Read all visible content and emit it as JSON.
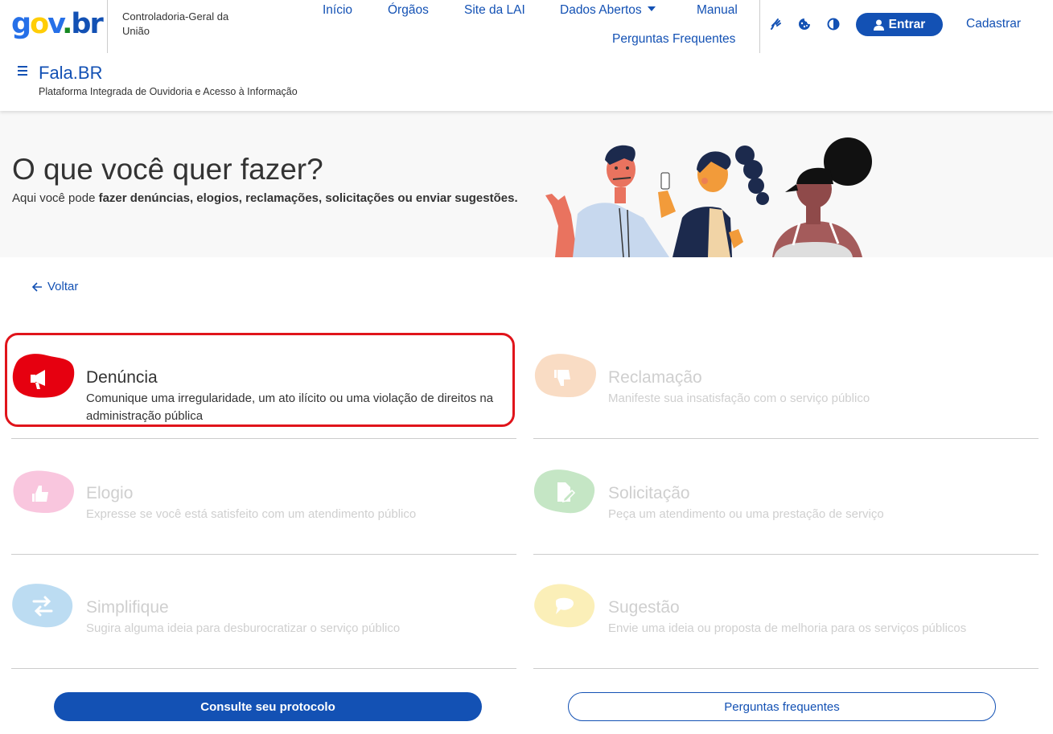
{
  "header": {
    "logo": {
      "g": "g",
      "o": "o",
      "v": "v",
      "dot": ".",
      "b": "b",
      "r": "r"
    },
    "org_name": "Controladoria-Geral da União",
    "nav": {
      "inicio": "Início",
      "orgaos": "Órgãos",
      "site_lai": "Site da LAI",
      "dados_abertos": "Dados Abertos",
      "manual": "Manual",
      "perguntas": "Perguntas Frequentes"
    },
    "tools": [
      "sign-language-icon",
      "cookie-icon",
      "contrast-icon"
    ],
    "entrar": "Entrar",
    "cadastrar": "Cadastrar",
    "site_title": "Fala.BR",
    "site_subtitle": "Plataforma Integrada de Ouvidoria e Acesso à Informação"
  },
  "banner": {
    "title": "O que você quer fazer?",
    "subtitle_prefix": "Aqui você pode ",
    "subtitle_bold": "fazer denúncias, elogios, reclamações, solicitações ou enviar sugestões."
  },
  "back_label": "Voltar",
  "options": [
    {
      "title": "Denúncia",
      "description": "Comunique uma irregularidade, um ato ilícito ou uma violação de direitos na administração pública",
      "icon": "megaphone-icon",
      "color": "#e60010",
      "state": "selected"
    },
    {
      "title": "Reclamação",
      "description": "Manifeste sua insatisfação com o serviço público",
      "icon": "thumbs-down-icon",
      "color": "#f9dcc4",
      "state": "disabled"
    },
    {
      "title": "Elogio",
      "description": "Expresse se você está satisfeito com um atendimento público",
      "icon": "thumbs-up-icon",
      "color": "#f9c6de",
      "state": "disabled"
    },
    {
      "title": "Solicitação",
      "description": "Peça um atendimento ou uma prestação de serviço",
      "icon": "document-edit-icon",
      "color": "#c5e6c5",
      "state": "disabled"
    },
    {
      "title": "Simplifique",
      "description": "Sugira alguma ideia para desburocratizar o serviço público",
      "icon": "arrows-exchange-icon",
      "color": "#bcdcf2",
      "state": "disabled"
    },
    {
      "title": "Sugestão",
      "description": "Envie uma ideia ou proposta de melhoria para os serviços públicos",
      "icon": "speech-bubble-icon",
      "color": "#fbefb8",
      "state": "disabled"
    }
  ],
  "buttons": {
    "consulte": "Consulte seu protocolo",
    "perguntas": "Perguntas frequentes"
  },
  "colors": {
    "brand_blue": "#1351b4",
    "highlight_red": "#e0141b",
    "banner_bg": "#f8f8f8"
  }
}
